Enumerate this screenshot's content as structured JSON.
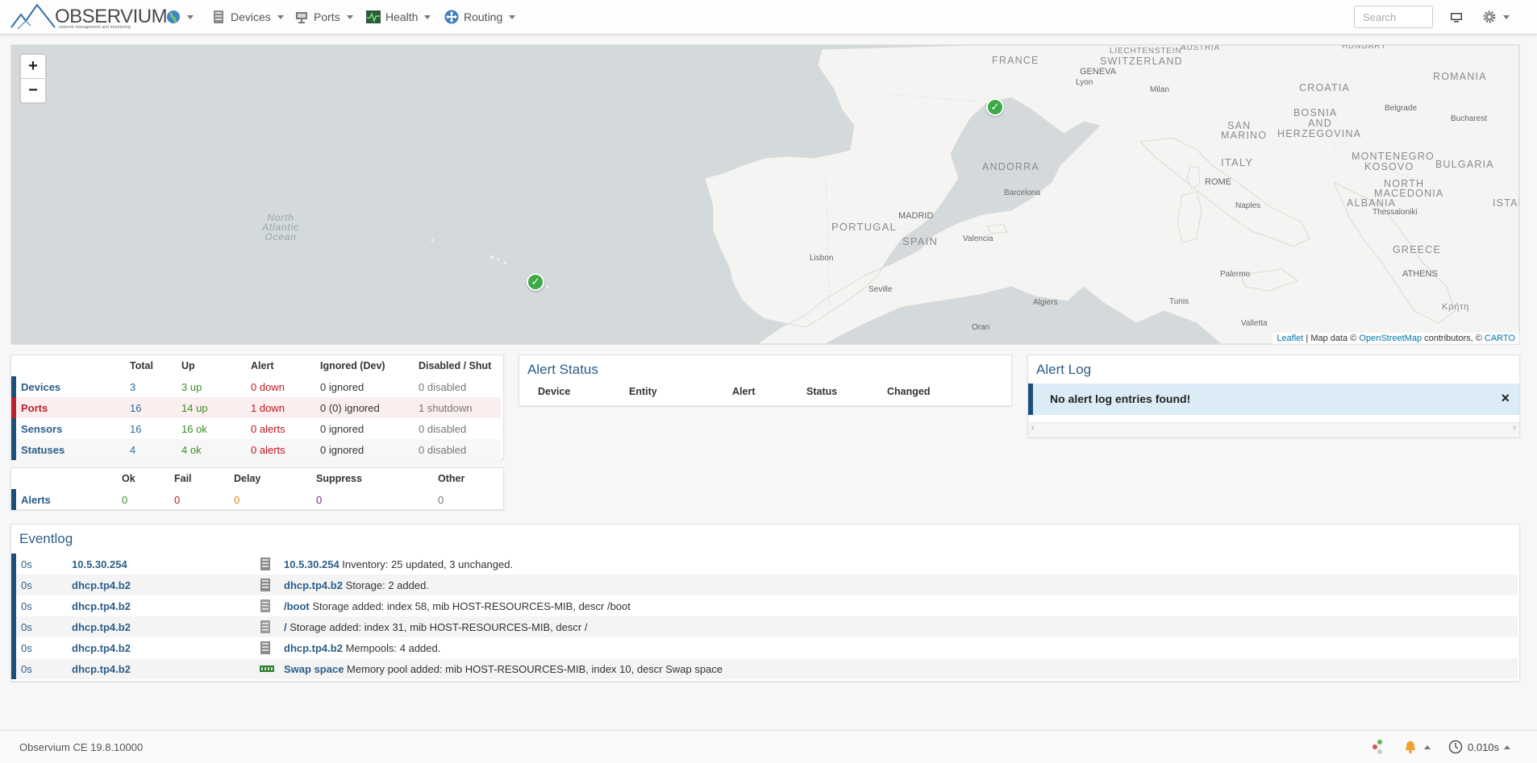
{
  "app": {
    "logo_text": "OBSERVIUM",
    "logo_sub": "network management and monitoring"
  },
  "navbar": {
    "items": [
      {
        "label": "",
        "icon": "globe-icon"
      },
      {
        "label": "Devices",
        "icon": "server-icon"
      },
      {
        "label": "Ports",
        "icon": "network-port-icon"
      },
      {
        "label": "Health",
        "icon": "heartbeat-icon"
      },
      {
        "label": "Routing",
        "icon": "routing-icon"
      }
    ],
    "search_placeholder": "Search",
    "right_icons": [
      "monitor-icon",
      "gear-icon"
    ]
  },
  "map": {
    "zoom_in": "+",
    "zoom_out": "−",
    "attribution": {
      "leaflet": "Leaflet",
      "mid": " | Map data © ",
      "osm": "OpenStreetMap",
      "mid2": " contributors, © ",
      "carto": "CARTO"
    },
    "labels": {
      "france": "FRANCE",
      "switzerland": "SWITZERLAND",
      "liechtenstein": "LIECHTENSTEIN",
      "austria": "AUSTRIA",
      "hungary": "HUNGARY",
      "romania": "ROMANIA",
      "croatia": "CROATIA",
      "bosnia1": "BOSNIA",
      "bosnia2": "AND",
      "bosnia3": "HERZEGOVINA",
      "san1": "SAN",
      "san2": "MARINO",
      "montenegro": "MONTENEGRO",
      "kosovo": "KOSOVO",
      "bulgaria": "BULGARIA",
      "north_macedonia1": "NORTH",
      "north_macedonia2": "MACEDONIA",
      "albania": "ALBANIA",
      "greece": "GREECE",
      "italy": "ITALY",
      "andorra": "ANDORRA",
      "portugal": "PORTUGAL",
      "spain": "SPAIN",
      "istanbul": "ISTANB",
      "kriti": "Κρήτη",
      "geneva": "GENEVA",
      "lyon": "Lyon",
      "milan": "Milan",
      "belgrade": "Belgrade",
      "bucharest": "Bucharest",
      "rome": "ROME",
      "naples": "Naples",
      "thessaloniki": "Thessaloniki",
      "athens": "ATHENS",
      "barcelona": "Barcelona",
      "madrid": "MADRID",
      "valencia": "Valencia",
      "lisbon": "Lisbon",
      "seville": "Seville",
      "algiers": "Algiers",
      "tunis": "Tunis",
      "palermo": "Palermo",
      "valletta": "Valletta",
      "oran": "Oran",
      "ocean1": "North",
      "ocean2": "Atlantic",
      "ocean3": "Ocean"
    }
  },
  "status_table": {
    "headers": [
      "",
      "Total",
      "Up",
      "Alert",
      "Ignored (Dev)",
      "Disabled / Shut"
    ],
    "rows": [
      {
        "name": "Devices",
        "total": "3",
        "up": "3 up",
        "alert": "0 down",
        "ignored": "0 ignored",
        "disabled": "0 disabled"
      },
      {
        "name": "Ports",
        "total": "16",
        "up": "14 up",
        "alert": "1 down",
        "ignored": "0 (0) ignored",
        "disabled": "1 shutdown"
      },
      {
        "name": "Sensors",
        "total": "16",
        "up": "16 ok",
        "alert": "0 alerts",
        "ignored": "0 ignored",
        "disabled": "0 disabled"
      },
      {
        "name": "Statuses",
        "total": "4",
        "up": "4 ok",
        "alert": "0 alerts",
        "ignored": "0 ignored",
        "disabled": "0 disabled"
      }
    ]
  },
  "alerts_table": {
    "headers": [
      "",
      "Ok",
      "Fail",
      "Delay",
      "Suppress",
      "Other"
    ],
    "row": {
      "name": "Alerts",
      "ok": "0",
      "fail": "0",
      "delay": "0",
      "suppress": "0",
      "other": "0"
    }
  },
  "alert_status": {
    "title": "Alert Status",
    "headers": [
      "Device",
      "Entity",
      "Alert",
      "Status",
      "Changed"
    ]
  },
  "alert_log": {
    "title": "Alert Log",
    "message": "No alert log entries found!",
    "close": "×"
  },
  "eventlog": {
    "title": "Eventlog",
    "rows": [
      {
        "time": "0s",
        "host": "10.5.30.254",
        "icon": "server-icon",
        "entity": "10.5.30.254",
        "message": " Inventory: 25 updated, 3 unchanged."
      },
      {
        "time": "0s",
        "host": "dhcp.tp4.b2",
        "icon": "server-icon",
        "entity": "dhcp.tp4.b2",
        "message": " Storage: 2 added."
      },
      {
        "time": "0s",
        "host": "dhcp.tp4.b2",
        "icon": "storage-icon",
        "entity": "/boot",
        "message": " Storage added: index 58, mib HOST-RESOURCES-MIB, descr /boot"
      },
      {
        "time": "0s",
        "host": "dhcp.tp4.b2",
        "icon": "storage-icon",
        "entity": "/",
        "message": " Storage added: index 31, mib HOST-RESOURCES-MIB, descr /"
      },
      {
        "time": "0s",
        "host": "dhcp.tp4.b2",
        "icon": "server-icon",
        "entity": "dhcp.tp4.b2",
        "message": " Mempools: 4 added."
      },
      {
        "time": "0s",
        "host": "dhcp.tp4.b2",
        "icon": "memory-icon",
        "entity": "Swap space",
        "message": " Memory pool added: mib HOST-RESOURCES-MIB, index 10, descr Swap space"
      }
    ]
  },
  "footer": {
    "version": "Observium CE 19.8.10000",
    "timing": "0.010s"
  }
}
